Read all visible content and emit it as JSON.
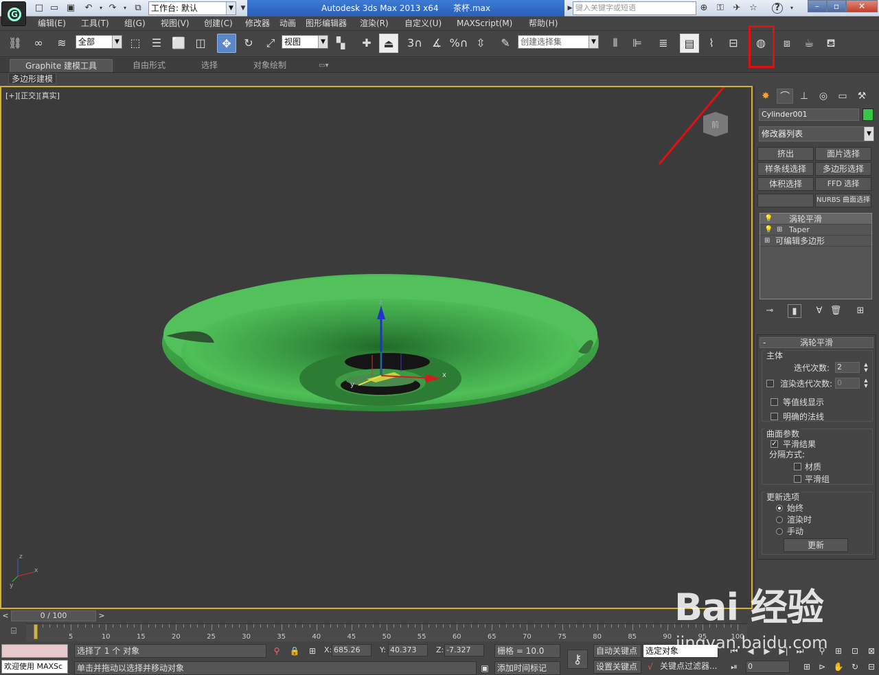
{
  "titlebar": {
    "workspace": "工作台: 默认",
    "app_title": "Autodesk 3ds Max  2013 x64",
    "file_name": "茶杯.max",
    "search_placeholder": "键入关键字或短语",
    "help_label": "?"
  },
  "menubar": {
    "items": [
      "编辑(E)",
      "工具(T)",
      "组(G)",
      "视图(V)",
      "创建(C)",
      "修改器",
      "动画",
      "图形编辑器",
      "渲染(R)",
      "自定义(U)",
      "MAXScript(M)",
      "帮助(H)"
    ]
  },
  "toolbar": {
    "selection_filter": "全部",
    "ref_coord": "视图",
    "named_selection": "创建选择集",
    "snap_labels": [
      "3",
      "%"
    ],
    "highlight_color": "#e01010"
  },
  "ribbon": {
    "tabs": [
      "Graphite 建模工具",
      "自由形式",
      "选择",
      "对象绘制"
    ],
    "sub_label": "多边形建模"
  },
  "viewport": {
    "label": "[+][正交][真实]",
    "active_border_color": "#d7b030",
    "viewcube_face": "前",
    "object_color": "#36c845",
    "gizmo_axes": [
      "x",
      "y",
      "z"
    ]
  },
  "command_panel": {
    "object_name": "Cylinder001",
    "object_color": "#36c845",
    "modifier_list": "修改器列表",
    "modifier_buttons": [
      "挤出",
      "面片选择",
      "样条线选择",
      "多边形选择",
      "体积选择",
      "FFD 选择",
      "",
      "NURBS 曲面选择"
    ],
    "stack": [
      "涡轮平滑",
      "Taper",
      "可编辑多边形"
    ],
    "rollout": {
      "title": "涡轮平滑",
      "group_main": "主体",
      "iterations_label": "迭代次数:",
      "iterations_value": "2",
      "render_iters_label": "渲染迭代次数:",
      "render_iters_value": "0",
      "render_iters_checked": false,
      "isoline_label": "等值线显示",
      "isoline_checked": false,
      "explicit_normals_label": "明确的法线",
      "explicit_normals_checked": false,
      "group_surface": "曲面参数",
      "smooth_result_label": "平滑结果",
      "smooth_result_checked": true,
      "separate_by_label": "分隔方式:",
      "materials_label": "材质",
      "materials_checked": false,
      "smoothing_groups_label": "平滑组",
      "smoothing_groups_checked": false,
      "group_update": "更新选项",
      "update_always": "始终",
      "update_render": "渲染时",
      "update_manual": "手动",
      "update_selected": "始终",
      "update_button": "更新"
    }
  },
  "timeline": {
    "frame_display": "0 / 100",
    "ticks": [
      0,
      5,
      10,
      15,
      20,
      25,
      30,
      35,
      40,
      45,
      50,
      55,
      60,
      65,
      70,
      75,
      80,
      85,
      90,
      95,
      100
    ],
    "current_frame": 0
  },
  "statusbar": {
    "welcome": "欢迎使用 MAXSc",
    "selection_status": "选择了 1 个 对象",
    "prompt": "单击并拖动以选择并移动对象",
    "x_label": "X:",
    "x_value": "685.26",
    "y_label": "Y:",
    "y_value": "40.373",
    "z_label": "Z:",
    "z_value": "-7.327",
    "grid": "栅格 = 10.0",
    "add_time_tag": "添加时间标记",
    "auto_key": "自动关键点",
    "set_key": "设置关键点",
    "key_mode": "选定对象",
    "key_filters": "关键点过滤器...",
    "frame_field": "0"
  },
  "watermark": {
    "brand": "Bai 经验",
    "url": "jingyan.baidu.com"
  }
}
